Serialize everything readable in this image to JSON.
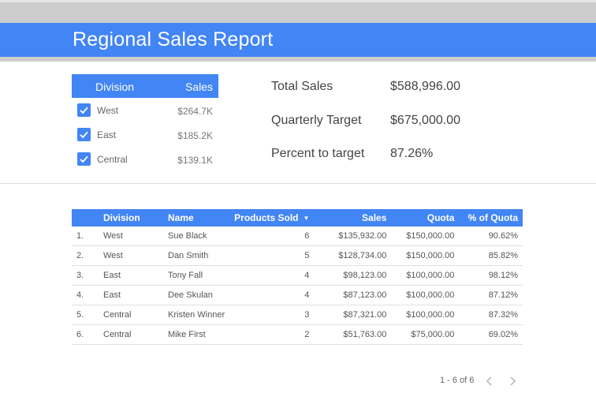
{
  "report": {
    "title": "Regional Sales Report"
  },
  "filter": {
    "header_division": "Division",
    "header_sales": "Sales",
    "items": [
      {
        "label": "West",
        "value": "$264.7K",
        "checked": true
      },
      {
        "label": "East",
        "value": "$185.2K",
        "checked": true
      },
      {
        "label": "Central",
        "value": "$139.1K",
        "checked": true
      }
    ]
  },
  "kpis": [
    {
      "label": "Total Sales",
      "value": "$588,996.00"
    },
    {
      "label": "Quarterly Target",
      "value": "$675,000.00"
    },
    {
      "label": "Percent to target",
      "value": "87.26%"
    }
  ],
  "table": {
    "columns": {
      "division": "Division",
      "name": "Name",
      "products_sold": "Products Sold",
      "sales": "Sales",
      "quota": "Quota",
      "pct_quota": "% of Quota"
    },
    "sort_indicator": "▼",
    "rows": [
      {
        "index": "1.",
        "division": "West",
        "name": "Sue Black",
        "products_sold": "6",
        "sales": "$135,932.00",
        "quota": "$150,000.00",
        "pct_quota": "90.62%"
      },
      {
        "index": "2.",
        "division": "West",
        "name": "Dan Smith",
        "products_sold": "5",
        "sales": "$128,734.00",
        "quota": "$150,000.00",
        "pct_quota": "85.82%"
      },
      {
        "index": "3.",
        "division": "East",
        "name": "Tony Fall",
        "products_sold": "4",
        "sales": "$98,123.00",
        "quota": "$100,000.00",
        "pct_quota": "98.12%"
      },
      {
        "index": "4.",
        "division": "East",
        "name": "Dee Skulan",
        "products_sold": "4",
        "sales": "$87,123.00",
        "quota": "$100,000.00",
        "pct_quota": "87.12%"
      },
      {
        "index": "5.",
        "division": "Central",
        "name": "Kristen Winner",
        "products_sold": "3",
        "sales": "$87,321.00",
        "quota": "$100,000.00",
        "pct_quota": "87.32%"
      },
      {
        "index": "6.",
        "division": "Central",
        "name": "Mike First",
        "products_sold": "2",
        "sales": "$51,763.00",
        "quota": "$75,000.00",
        "pct_quota": "69.02%"
      }
    ]
  },
  "pager": {
    "text": "1 - 6 of 6",
    "prev_icon": "chevron-left-icon",
    "next_icon": "chevron-right-icon"
  },
  "colors": {
    "accent": "#4285f4",
    "header_strip": "#cdcdcd"
  }
}
